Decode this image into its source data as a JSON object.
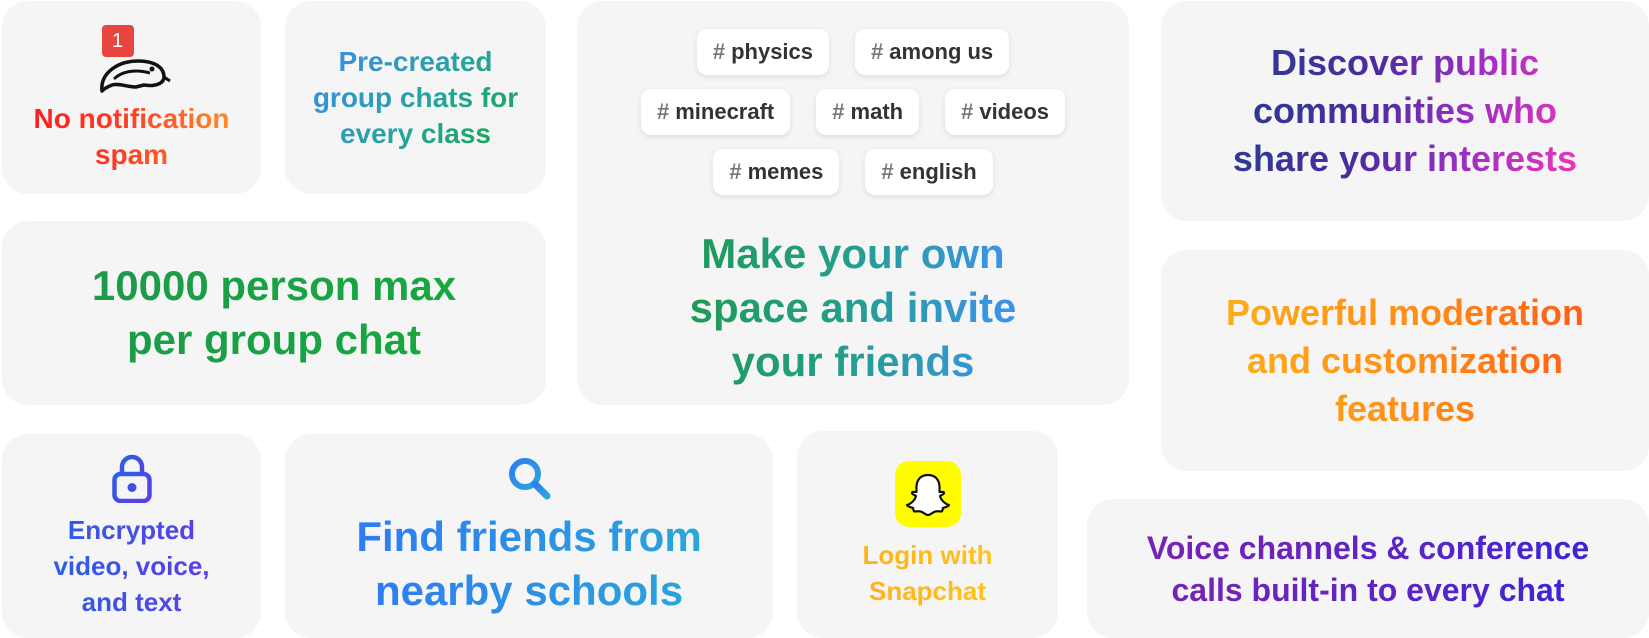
{
  "cards": {
    "spam": {
      "badge": "1",
      "lines": [
        "No notification",
        "spam"
      ]
    },
    "class_chats": {
      "lines": [
        "Pre-created",
        "group chats for",
        "every class"
      ]
    },
    "tags": {
      "hash": "#",
      "rows": [
        [
          "physics",
          "among us"
        ],
        [
          "minecraft",
          "math",
          "videos"
        ],
        [
          "memes",
          "english"
        ]
      ],
      "headline": [
        "Make your own",
        "space and invite",
        "your friends"
      ]
    },
    "discover": {
      "lines": [
        "Discover public",
        "communities who",
        "share your interests"
      ]
    },
    "max_size": {
      "lines": [
        "10000 person max",
        "per group chat"
      ]
    },
    "moderation": {
      "lines": [
        "Powerful moderation",
        "and customization",
        "features"
      ]
    },
    "encrypted": {
      "icon": "lock-icon",
      "lines": [
        "Encrypted",
        "video, voice,",
        "and text"
      ]
    },
    "find_friends": {
      "icon": "search-icon",
      "lines": [
        "Find friends from",
        "nearby schools"
      ]
    },
    "snapchat": {
      "icon": "snapchat-ghost-icon",
      "lines": [
        "Login with",
        "Snapchat"
      ]
    },
    "voice": {
      "lines": [
        "Voice channels & conference",
        "calls built-in to every chat"
      ]
    }
  },
  "colors": {
    "card_bg": "#f5f5f5",
    "badge": "#e9453f",
    "snap_yellow": "#fffc00"
  }
}
